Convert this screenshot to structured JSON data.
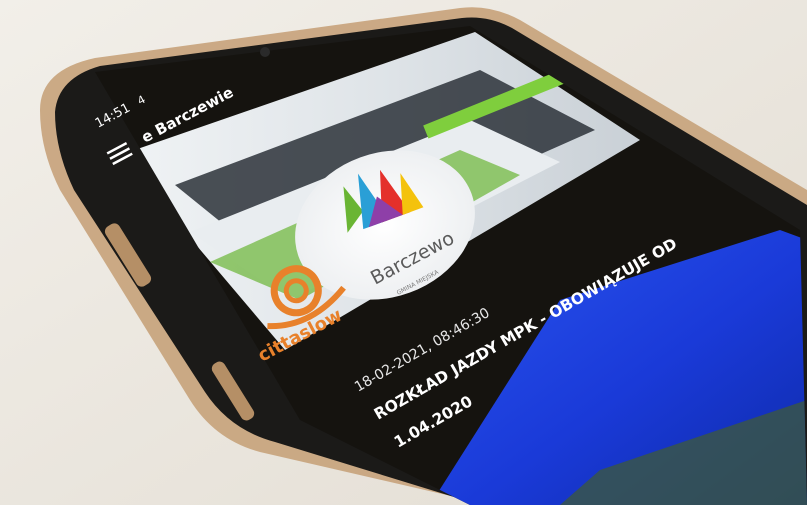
{
  "status_bar": {
    "time": "14:51",
    "signal": "4"
  },
  "app_bar": {
    "title": "e Barczewie"
  },
  "hero": {
    "town_logo_text": "Barczewo",
    "town_logo_subtext": "GMINA MIEJSKA",
    "cittaslow_logo_text": "cittaslow"
  },
  "article": {
    "timestamp": "18-02-2021, 08:46:30",
    "headline_line1": "ROZKŁAD JAZDY MPK - OBOWIĄZUJE OD",
    "headline_line2": "1.04.2020"
  },
  "colors": {
    "screen_dark": "#15130f",
    "logo_blue": "#2a9fd6",
    "logo_green": "#6ab534",
    "logo_red": "#e4302b",
    "snail_orange": "#e8812b",
    "thumbnail_blue": "#1f4be0"
  }
}
